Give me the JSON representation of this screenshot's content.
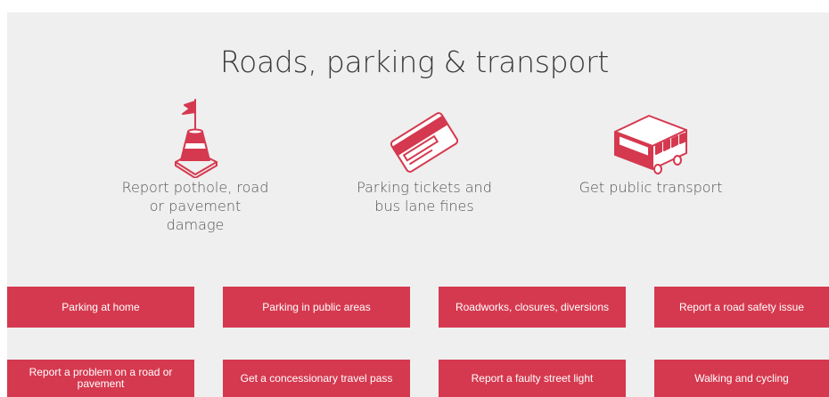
{
  "page": {
    "title": "Roads, parking & transport"
  },
  "features": [
    {
      "label": "Report pothole, road or pavement damage",
      "icon": "traffic-cone-icon"
    },
    {
      "label": "Parking tickets and bus lane fines",
      "icon": "ticket-card-icon"
    },
    {
      "label": "Get public transport",
      "icon": "bus-icon"
    }
  ],
  "buttons": [
    {
      "label": "Parking at home"
    },
    {
      "label": "Parking in public areas"
    },
    {
      "label": "Roadworks, closures, diversions"
    },
    {
      "label": "Report a road safety issue"
    },
    {
      "label": "Report a problem on a road or pavement"
    },
    {
      "label": "Get a concessionary travel pass"
    },
    {
      "label": "Report a faulty street light"
    },
    {
      "label": "Walking and cycling"
    }
  ],
  "colors": {
    "accent": "#d5394f",
    "panel_background": "#efefef",
    "text": "#555555"
  }
}
